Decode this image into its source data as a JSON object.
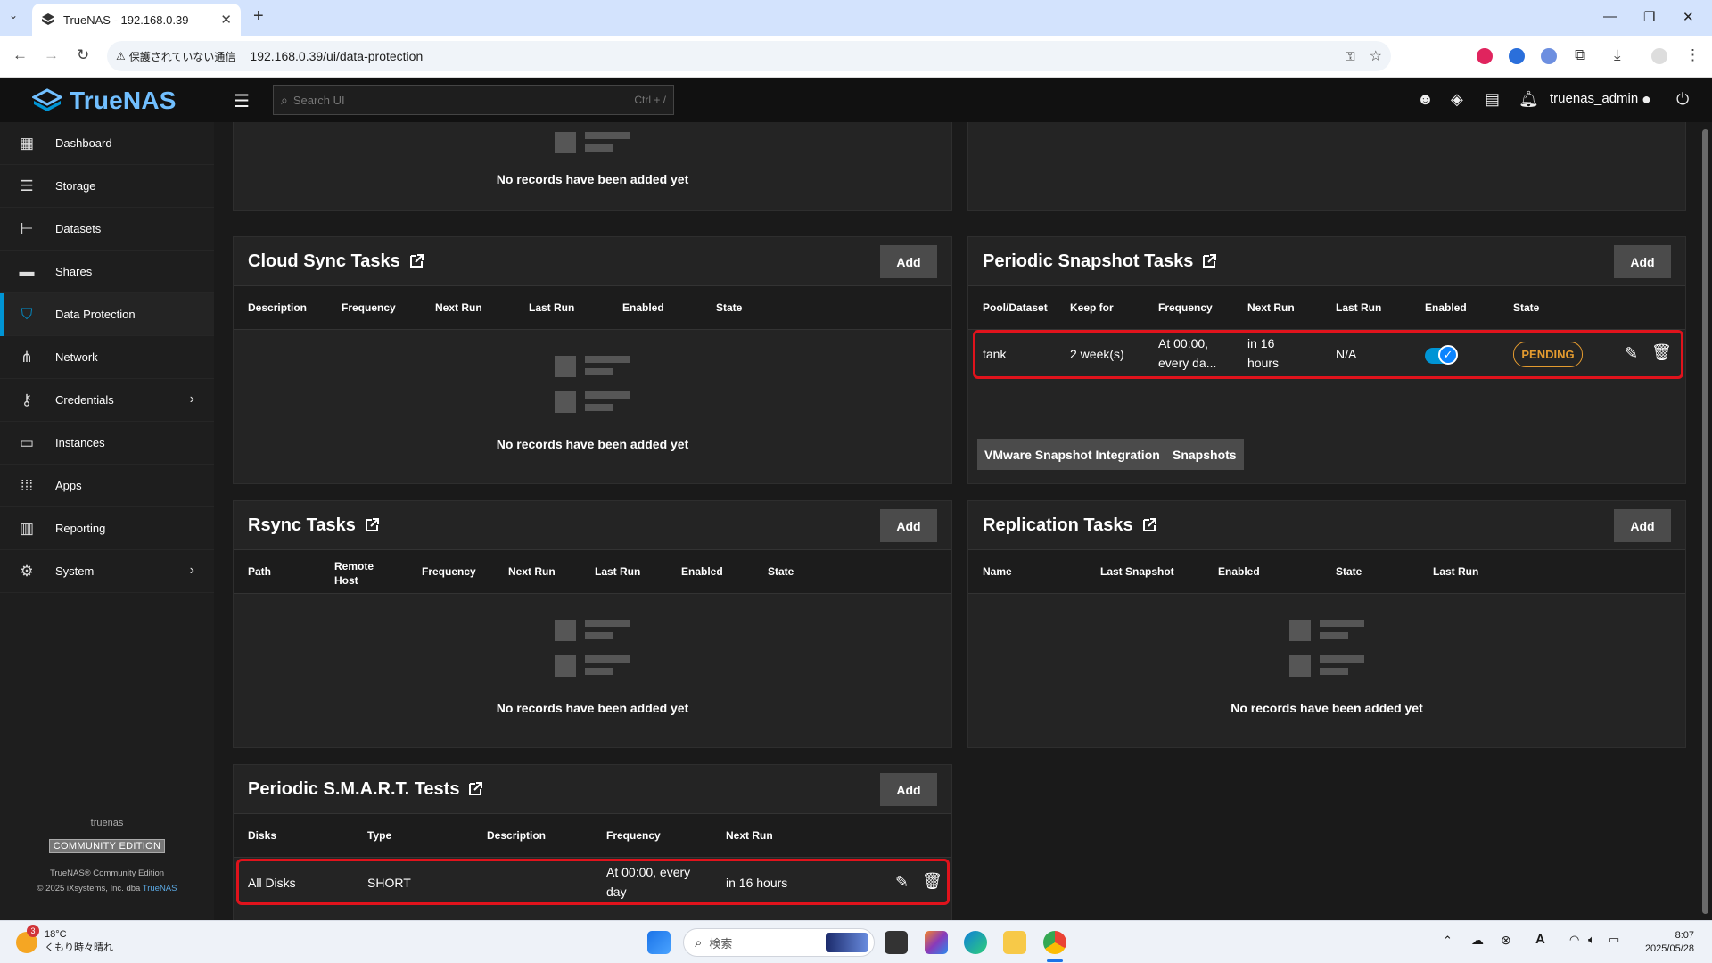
{
  "browser": {
    "tab_title": "TrueNAS - 192.168.0.39",
    "security_label": "保護されていない通信",
    "url": "192.168.0.39/ui/data-protection"
  },
  "header": {
    "logo_text": "TrueNAS",
    "search_placeholder": "Search UI",
    "search_shortcut": "Ctrl + /",
    "username": "truenas_admin"
  },
  "sidebar": {
    "items": [
      {
        "label": "Dashboard",
        "icon": "dashboard-icon"
      },
      {
        "label": "Storage",
        "icon": "storage-icon"
      },
      {
        "label": "Datasets",
        "icon": "datasets-icon"
      },
      {
        "label": "Shares",
        "icon": "shares-icon"
      },
      {
        "label": "Data Protection",
        "icon": "shield-icon",
        "active": true
      },
      {
        "label": "Network",
        "icon": "network-icon"
      },
      {
        "label": "Credentials",
        "icon": "key-icon",
        "expandable": true
      },
      {
        "label": "Instances",
        "icon": "laptop-icon"
      },
      {
        "label": "Apps",
        "icon": "apps-grid-icon"
      },
      {
        "label": "Reporting",
        "icon": "chart-icon"
      },
      {
        "label": "System",
        "icon": "gear-icon",
        "expandable": true
      }
    ],
    "hostname": "truenas",
    "edition": "COMMUNITY EDITION",
    "product_line": "TrueNAS® Community Edition",
    "copyright": "© 2025 iXsystems, Inc. dba",
    "copyright_link": "TrueNAS"
  },
  "empty_message": "No records have been added yet",
  "add_label": "Add",
  "cloud_sync": {
    "title": "Cloud Sync Tasks",
    "columns": [
      "Description",
      "Frequency",
      "Next Run",
      "Last Run",
      "Enabled",
      "State"
    ]
  },
  "periodic_snapshot": {
    "title": "Periodic Snapshot Tasks",
    "columns": [
      "Pool/Dataset",
      "Keep for",
      "Frequency",
      "Next Run",
      "Last Run",
      "Enabled",
      "State"
    ],
    "row": {
      "pool": "tank",
      "keep_for": "2 week(s)",
      "frequency_l1": "At 00:00,",
      "frequency_l2": "every da...",
      "next_run_l1": "in 16",
      "next_run_l2": "hours",
      "last_run": "N/A",
      "enabled": true,
      "state": "PENDING"
    },
    "vmware_button": "VMware Snapshot Integration",
    "snapshots_button": "Snapshots"
  },
  "rsync": {
    "title": "Rsync Tasks",
    "columns": [
      "Path",
      "Remote Host",
      "Frequency",
      "Next Run",
      "Last Run",
      "Enabled",
      "State"
    ],
    "remote_host_l1": "Remote",
    "remote_host_l2": "Host"
  },
  "replication": {
    "title": "Replication Tasks",
    "columns": [
      "Name",
      "Last Snapshot",
      "Enabled",
      "State",
      "Last Run"
    ]
  },
  "smart": {
    "title": "Periodic S.M.A.R.T. Tests",
    "columns": [
      "Disks",
      "Type",
      "Description",
      "Frequency",
      "Next Run"
    ],
    "row": {
      "disks": "All Disks",
      "type": "SHORT",
      "description": "",
      "frequency_l1": "At 00:00, every",
      "frequency_l2": "day",
      "next_run": "in 16 hours"
    }
  },
  "taskbar": {
    "weather_badge": "3",
    "temperature": "18°C",
    "weather_text": "くもり時々晴れ",
    "search_placeholder": "検索",
    "time": "8:07",
    "date": "2025/05/28"
  },
  "colors": {
    "accent": "#0095d5",
    "highlight": "#e0131c",
    "pending": "#e49b2f",
    "logo": "#71bfff"
  }
}
